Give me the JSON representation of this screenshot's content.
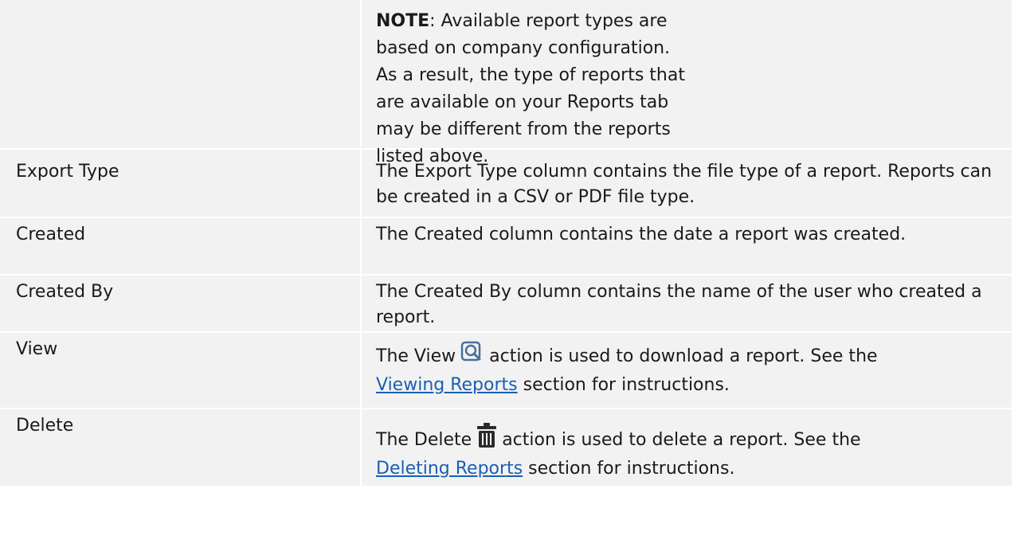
{
  "note": {
    "label": "NOTE",
    "text": ": Available report types are based on company configuration. As a result, the type of reports that are available on your Reports tab may be different from the reports listed above."
  },
  "rows": [
    {
      "term": "Export Type",
      "desc": "The Export Type column contains the file type of a report. Reports can be created in a CSV or PDF file type."
    },
    {
      "term": "Created",
      "desc": "The Created column contains the date a report was created."
    },
    {
      "term": "Created By",
      "desc": "The Created By column contains the name of the user who created a report."
    }
  ],
  "view": {
    "term": "View",
    "desc_before": "The View",
    "desc_after": "action is used to download a report. See the",
    "link": "Viewing Reports",
    "desc_end": "section for instructions.",
    "icon": "magnify-icon"
  },
  "delete": {
    "term": "Delete",
    "desc_before": "The Delete",
    "desc_after": "action is used to delete a report. See the",
    "link": "Deleting Reports",
    "desc_end": "section for instructions.",
    "icon": "trash-icon"
  },
  "colors": {
    "background": "#f2f2f2",
    "link": "#1a5fb4"
  }
}
